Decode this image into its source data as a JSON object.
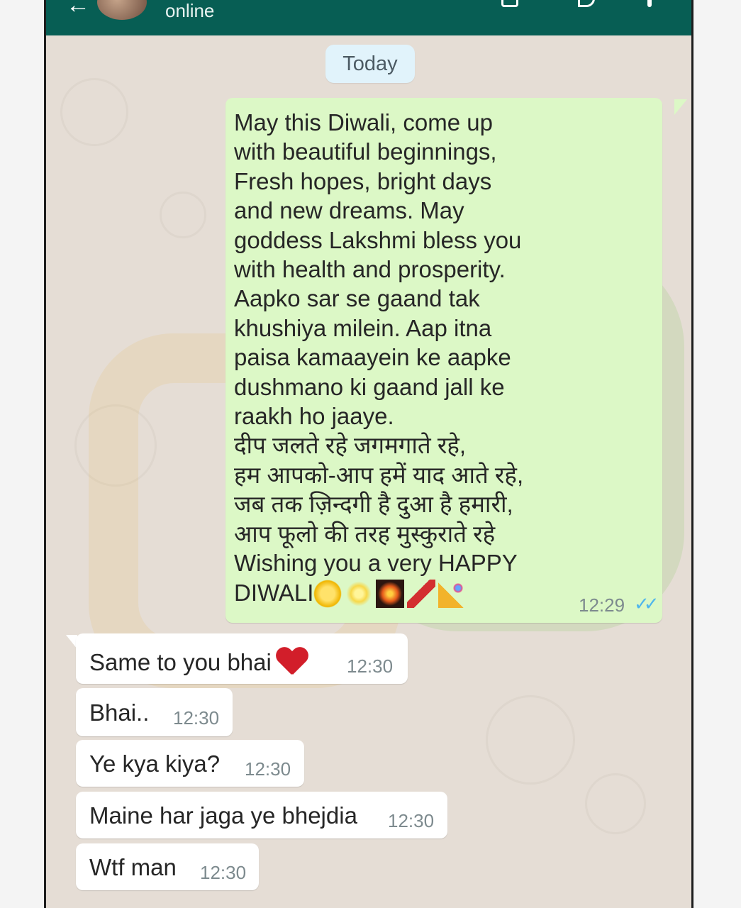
{
  "header": {
    "status": "online"
  },
  "chat": {
    "date_label": "Today",
    "outgoing": [
      {
        "text": "May this Diwali, come up\nwith beautiful beginnings,\nFresh hopes, bright days\nand new dreams. May\ngoddess Lakshmi bless you\nwith health and prosperity.\nAapko sar se gaand tak\nkhushiya milein. Aap itna\npaisa kamaayein ke aapke\ndushmano ki gaand jall ke\nraakh ho jaaye.\nदीप जलते रहे जगमगाते रहे,\nहम आपको-आप हमें याद आते रहे,\nजब तक ज़िन्दगी है दुआ है हमारी,\nआप फूलो की तरह मुस्कुराते रहे\nWishing you a very HAPPY\nDIWALI",
        "emojis": [
          "star-icon",
          "sparkles-icon",
          "fireworks-icon",
          "firecracker-icon",
          "party-popper-icon"
        ],
        "time": "12:29",
        "status_icon": "double-tick-icon"
      }
    ],
    "incoming": [
      {
        "text": "Same to you bhai",
        "emoji": "heart-icon",
        "time": "12:30"
      },
      {
        "text": "Bhai..",
        "time": "12:30"
      },
      {
        "text": "Ye kya kiya?",
        "time": "12:30"
      },
      {
        "text": "Maine har jaga ye bhejdia",
        "time": "12:30"
      },
      {
        "text": "Wtf man",
        "time": "12:30"
      }
    ]
  },
  "colors": {
    "header": "#075e54",
    "outgoing_bubble": "#dcf8c6",
    "incoming_bubble": "#ffffff",
    "wallpaper": "#e5ddd5",
    "tick": "#4fb6ec"
  }
}
